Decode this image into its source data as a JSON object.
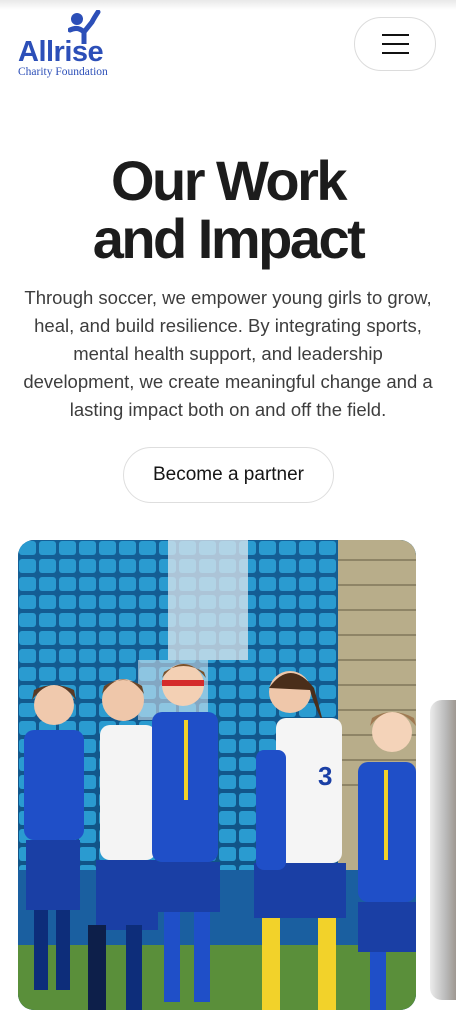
{
  "header": {
    "logo_word": "Allrise",
    "logo_sub": "Charity Foundation",
    "menu_icon": "hamburger-menu-icon"
  },
  "hero": {
    "title_line1": "Our Work",
    "title_line2": "and Impact",
    "description": "Through soccer, we empower young girls to grow, heal, and build resilience. By integrating sports, mental health support, and leadership development, we create meaningful change and a lasting impact both on and off the field.",
    "cta_label": "Become a partner"
  },
  "colors": {
    "brand_blue": "#2c4fb8",
    "text_dark": "#1c1c1c",
    "kit_blue": "#1f4fc8",
    "kit_yellow": "#f2d22a"
  }
}
